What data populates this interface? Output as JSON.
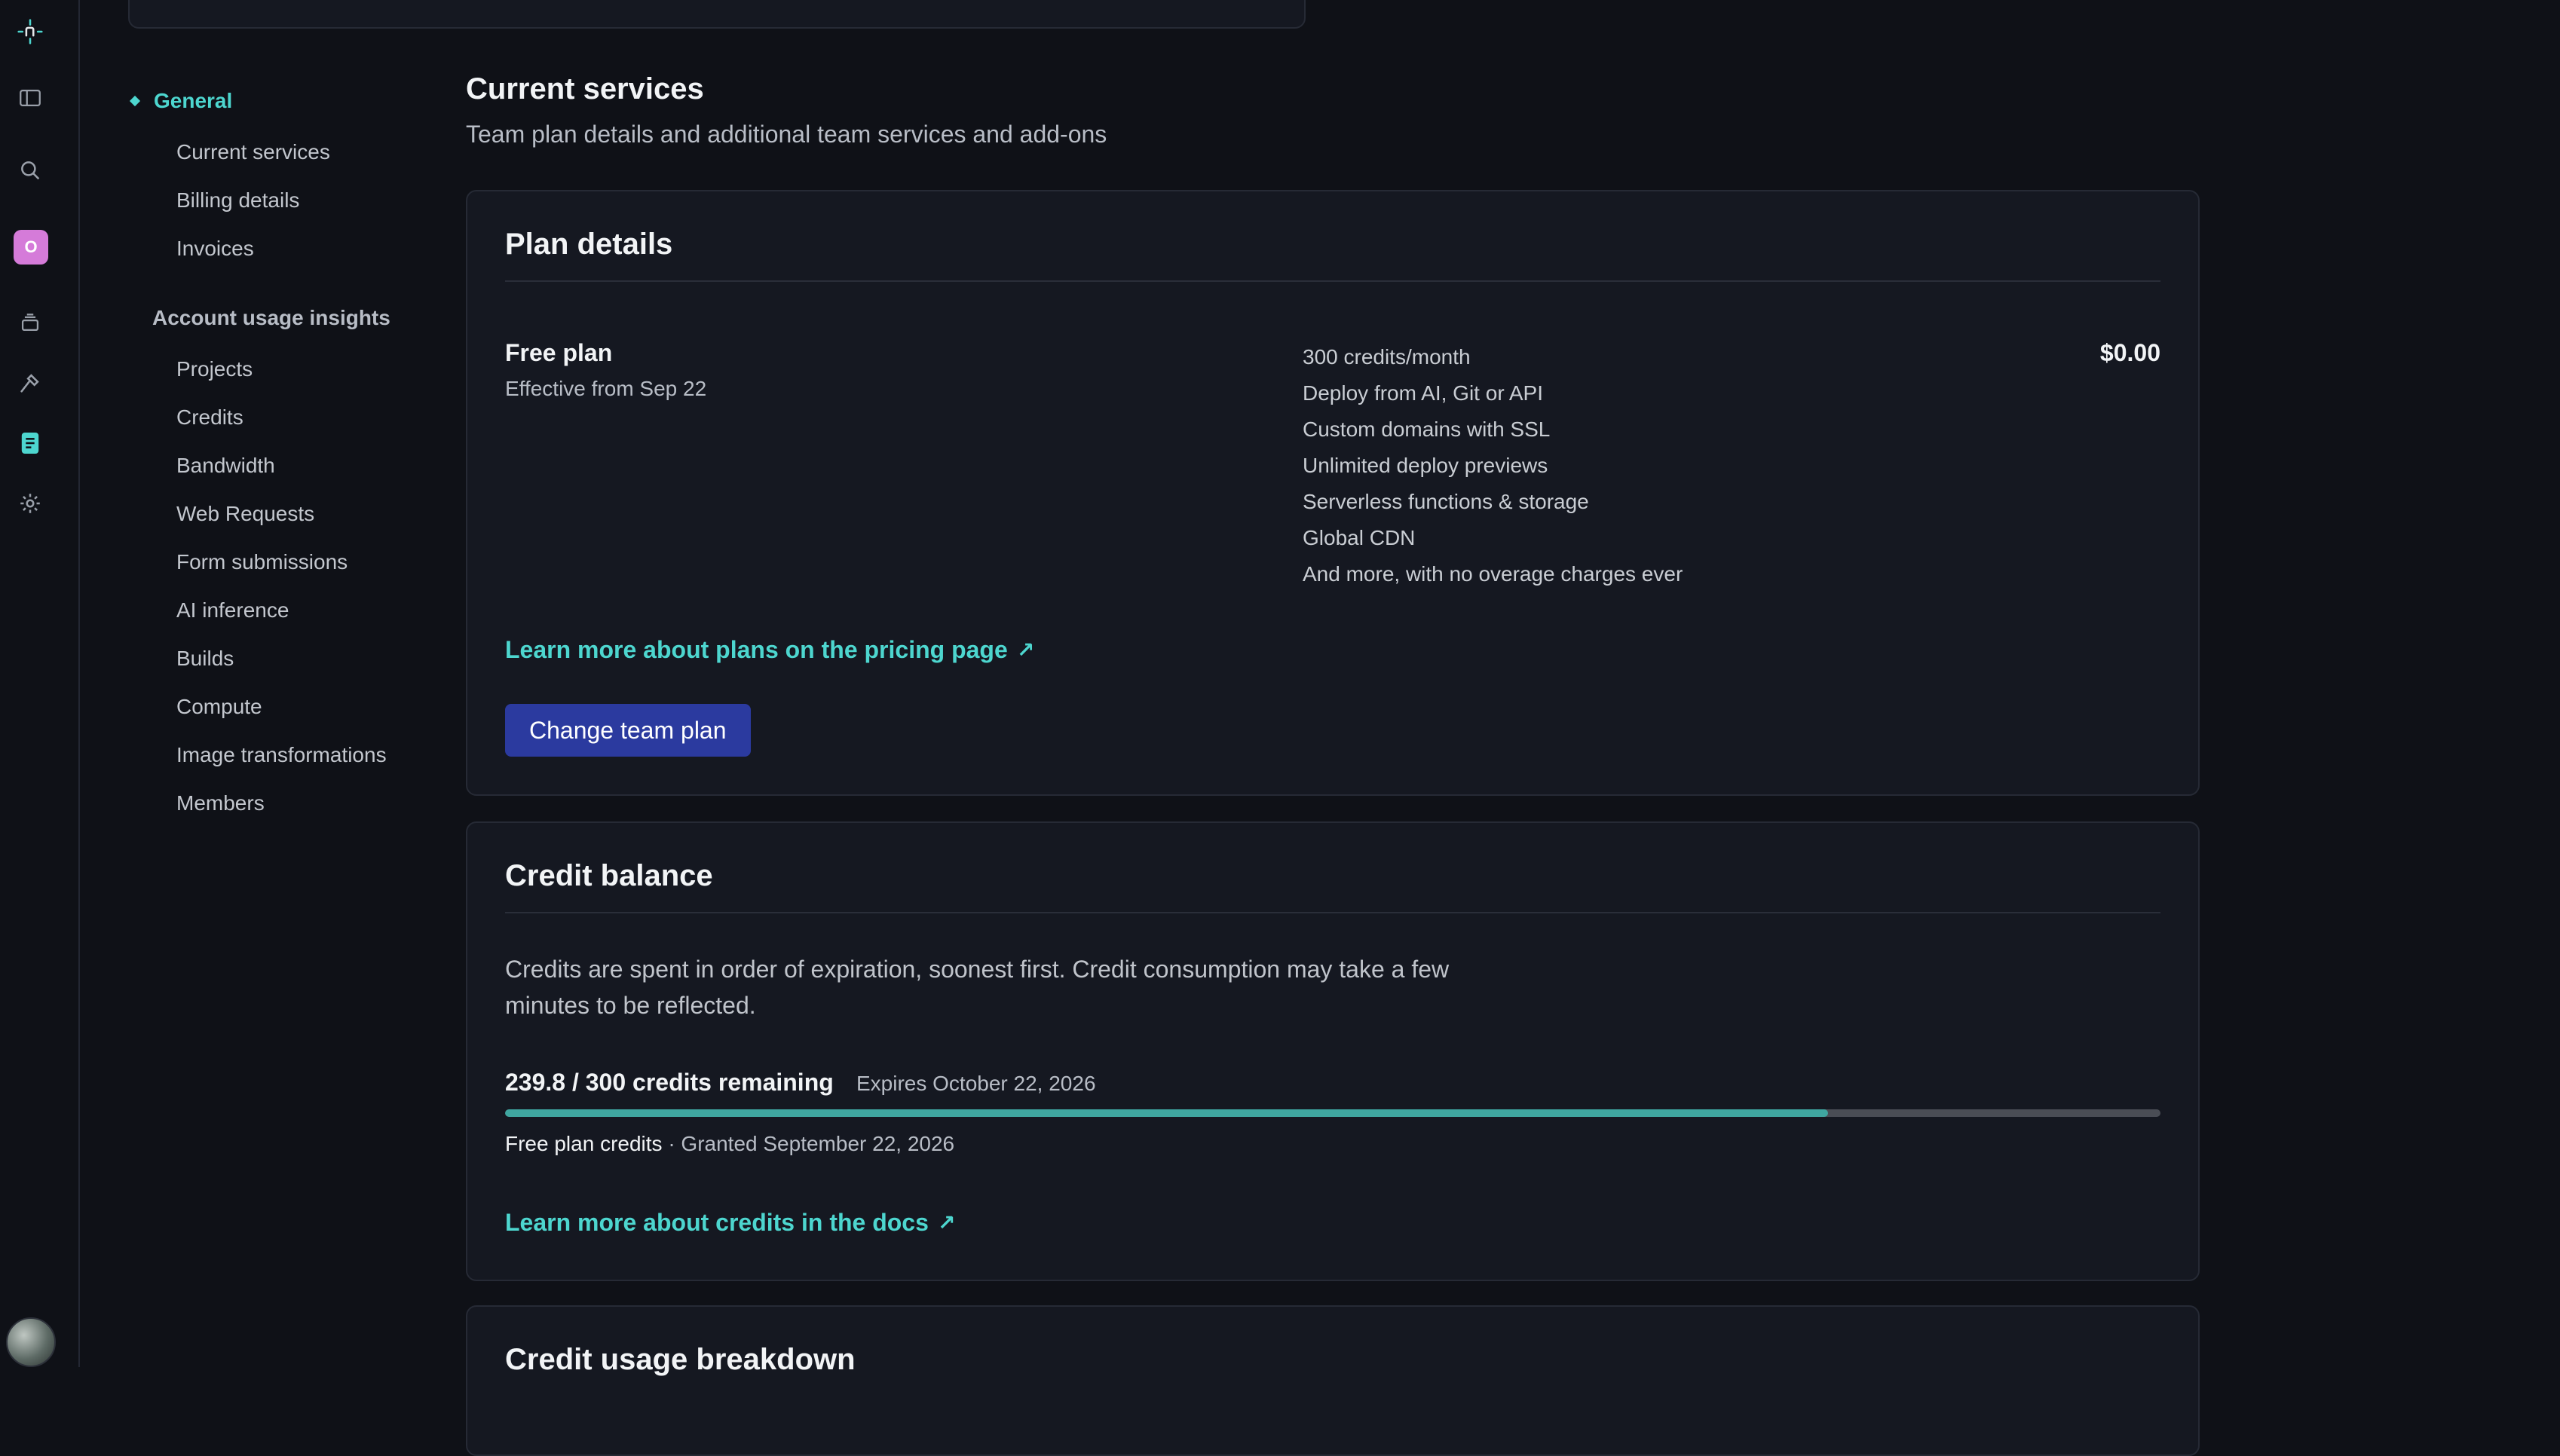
{
  "rail": {
    "logo_icon": "netlify-logo-icon",
    "org_initial": "O",
    "icons": [
      "sidebar-toggle-icon",
      "search-icon",
      "layers-icon",
      "hammer-icon",
      "billing-icon",
      "gear-icon"
    ],
    "active_accent": "#4dd6cf"
  },
  "subnav": {
    "general": {
      "label": "General",
      "items": [
        "Current services",
        "Billing details",
        "Invoices"
      ]
    },
    "usage": {
      "label": "Account usage insights",
      "items": [
        "Projects",
        "Credits",
        "Bandwidth",
        "Web Requests",
        "Form submissions",
        "AI inference",
        "Builds",
        "Compute",
        "Image transformations",
        "Members"
      ]
    }
  },
  "main": {
    "title": "Current services",
    "subtitle": "Team plan details and additional team services and add-ons"
  },
  "plan_card": {
    "title": "Plan details",
    "plan_name": "Free plan",
    "effective": "Effective from Sep 22",
    "features": [
      "300 credits/month",
      "Deploy from AI, Git or API",
      "Custom domains with SSL",
      "Unlimited deploy previews",
      "Serverless functions & storage",
      "Global CDN",
      "And more, with no overage charges ever"
    ],
    "price": "$0.00",
    "pricing_link": "Learn more about plans on the pricing page",
    "change_button": "Change team plan"
  },
  "credit_card": {
    "title": "Credit balance",
    "description": "Credits are spent in order of expiration, soonest first. Credit consumption may take a few minutes to be reflected.",
    "remaining": "239.8 / 300 credits remaining",
    "remaining_fraction": 0.7993,
    "expires": "Expires October 22, 2026",
    "source_name": "Free plan credits",
    "source_granted": " · Granted September 22, 2026",
    "docs_link": "Learn more about credits in the docs"
  },
  "usage_card": {
    "title": "Credit usage breakdown"
  },
  "colors": {
    "background": "#0f1117",
    "card": "#151821",
    "accent": "#4dd6cf",
    "button": "#2b3a9f",
    "progress_fill": "#3fa6a0"
  }
}
